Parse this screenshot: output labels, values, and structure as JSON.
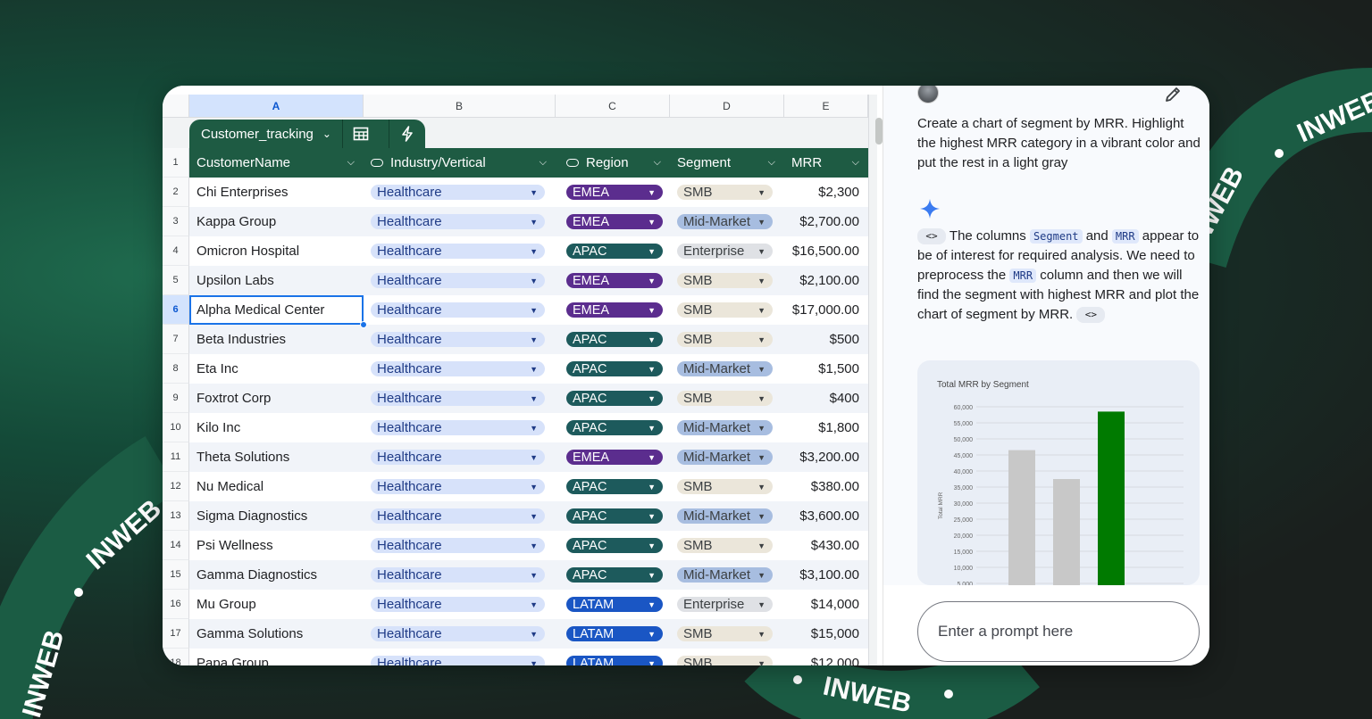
{
  "watermark": {
    "text": "INWEB"
  },
  "spreadsheet": {
    "columns": [
      "A",
      "B",
      "C",
      "D",
      "E"
    ],
    "table": {
      "name": "Customer_tracking"
    },
    "row_numbers": [
      "1",
      "2",
      "3",
      "4",
      "5",
      "6",
      "7",
      "8",
      "9",
      "10",
      "11",
      "12",
      "13",
      "14",
      "15",
      "16",
      "17",
      "18"
    ],
    "headers": {
      "name": "CustomerName",
      "industry": "Industry/Vertical",
      "region": "Region",
      "segment": "Segment",
      "mrr": "MRR"
    },
    "rows": [
      {
        "name": "Chi Enterprises",
        "industry": "Healthcare",
        "region": "EMEA",
        "segment": "SMB",
        "mrr": "$2,300"
      },
      {
        "name": "Kappa Group",
        "industry": "Healthcare",
        "region": "EMEA",
        "segment": "Mid-Market",
        "mrr": "$2,700.00"
      },
      {
        "name": "Omicron Hospital",
        "industry": "Healthcare",
        "region": "APAC",
        "segment": "Enterprise",
        "mrr": "$16,500.00"
      },
      {
        "name": "Upsilon Labs",
        "industry": "Healthcare",
        "region": "EMEA",
        "segment": "SMB",
        "mrr": "$2,100.00"
      },
      {
        "name": "Alpha Medical Center",
        "industry": "Healthcare",
        "region": "EMEA",
        "segment": "SMB",
        "mrr": "$17,000.00"
      },
      {
        "name": "Beta Industries",
        "industry": "Healthcare",
        "region": "APAC",
        "segment": "SMB",
        "mrr": "$500"
      },
      {
        "name": "Eta Inc",
        "industry": "Healthcare",
        "region": "APAC",
        "segment": "Mid-Market",
        "mrr": "$1,500"
      },
      {
        "name": "Foxtrot Corp",
        "industry": "Healthcare",
        "region": "APAC",
        "segment": "SMB",
        "mrr": "$400"
      },
      {
        "name": "Kilo Inc",
        "industry": "Healthcare",
        "region": "APAC",
        "segment": "Mid-Market",
        "mrr": "$1,800"
      },
      {
        "name": "Theta Solutions",
        "industry": "Healthcare",
        "region": "EMEA",
        "segment": "Mid-Market",
        "mrr": "$3,200.00"
      },
      {
        "name": "Nu Medical",
        "industry": "Healthcare",
        "region": "APAC",
        "segment": "SMB",
        "mrr": "$380.00"
      },
      {
        "name": "Sigma Diagnostics",
        "industry": "Healthcare",
        "region": "APAC",
        "segment": "Mid-Market",
        "mrr": "$3,600.00"
      },
      {
        "name": "Psi Wellness",
        "industry": "Healthcare",
        "region": "APAC",
        "segment": "SMB",
        "mrr": "$430.00"
      },
      {
        "name": "Gamma Diagnostics",
        "industry": "Healthcare",
        "region": "APAC",
        "segment": "Mid-Market",
        "mrr": "$3,100.00"
      },
      {
        "name": "Mu Group",
        "industry": "Healthcare",
        "region": "LATAM",
        "segment": "Enterprise",
        "mrr": "$14,000"
      },
      {
        "name": "Gamma Solutions",
        "industry": "Healthcare",
        "region": "LATAM",
        "segment": "SMB",
        "mrr": "$15,000"
      },
      {
        "name": "Papa Group",
        "industry": "Healthcare",
        "region": "LATAM",
        "segment": "SMB",
        "mrr": "$12,000"
      }
    ],
    "selected_row": "6",
    "region_colors": {
      "EMEA": "#5b2d8e",
      "APAC": "#1d5a5c",
      "LATAM": "#1a56c4"
    },
    "segment_colors": {
      "SMB": "#ebe6da",
      "Mid-Market": "#a7bde0",
      "Enterprise": "#dfe1e5"
    }
  },
  "assistant": {
    "user_prompt": "Create a chart of segment by MRR. Highlight the highest MRR category in a vibrant color and put the rest in a light gray",
    "response": {
      "part1": "The columns",
      "code1": "Segment",
      "part2": "and",
      "code2": "MRR",
      "part3": "appear to be of interest for required analysis. We need to preprocess the",
      "code3": "MRR",
      "part4": "column and then we will find the segment with highest MRR and plot the chart of segment by MRR.",
      "code_button": "<>"
    },
    "input_placeholder": "Enter a prompt here"
  },
  "chart_data": {
    "type": "bar",
    "title": "Total MRR by Segment",
    "ylabel": "Total MRR",
    "ylim": [
      0,
      60000
    ],
    "yticks": [
      5000,
      10000,
      15000,
      20000,
      25000,
      30000,
      35000,
      40000,
      45000,
      50000,
      55000,
      60000
    ],
    "values": [
      46500,
      37500,
      58500
    ],
    "colors": [
      "#c8c8c8",
      "#c8c8c8",
      "#007a00"
    ],
    "grid": true
  }
}
